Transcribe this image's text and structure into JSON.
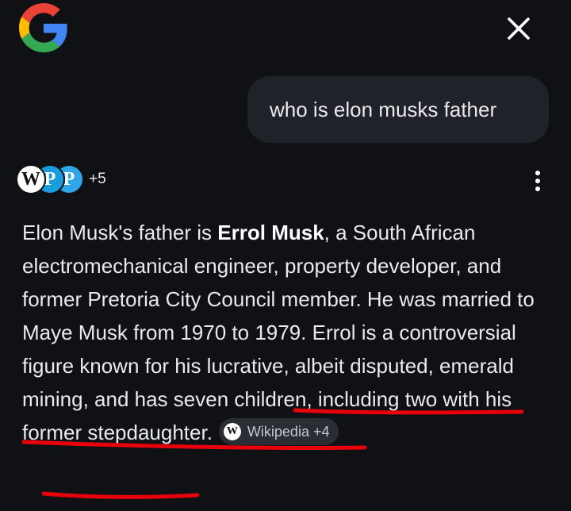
{
  "header": {
    "logo_icon": "google-g-logo",
    "close_icon": "close-x-icon"
  },
  "query": {
    "text": "who is elon musks father"
  },
  "sources": {
    "icons": [
      {
        "name": "wikipedia-icon",
        "letter": "W"
      },
      {
        "name": "source-p-icon",
        "letter": "P"
      },
      {
        "name": "source-p-icon",
        "letter": "P"
      }
    ],
    "more_count": "+5",
    "menu_icon": "more-vertical-icon"
  },
  "answer": {
    "part1": "Elon Musk's father is ",
    "bold": "Errol Musk",
    "part2": ", a South African electromechanical engineer, property developer, and former Pretoria City Council member. He was married to Maye Musk from 1970 to 1979. Errol is a controversial figure known for his lucrative, albeit disputed, emerald mining, and has seven children, including two with his former stepdaughter.",
    "chip": {
      "icon": "wikipedia-icon",
      "letter": "W",
      "label": "Wikipedia +4"
    }
  },
  "colors": {
    "background": "#0f1115",
    "bubble": "#1f2228",
    "text": "#e8eaed",
    "annotation_red": "#e8000b",
    "google_blue": "#4285F4",
    "google_red": "#EA4335",
    "google_yellow": "#FBBC05",
    "google_green": "#34A853"
  }
}
